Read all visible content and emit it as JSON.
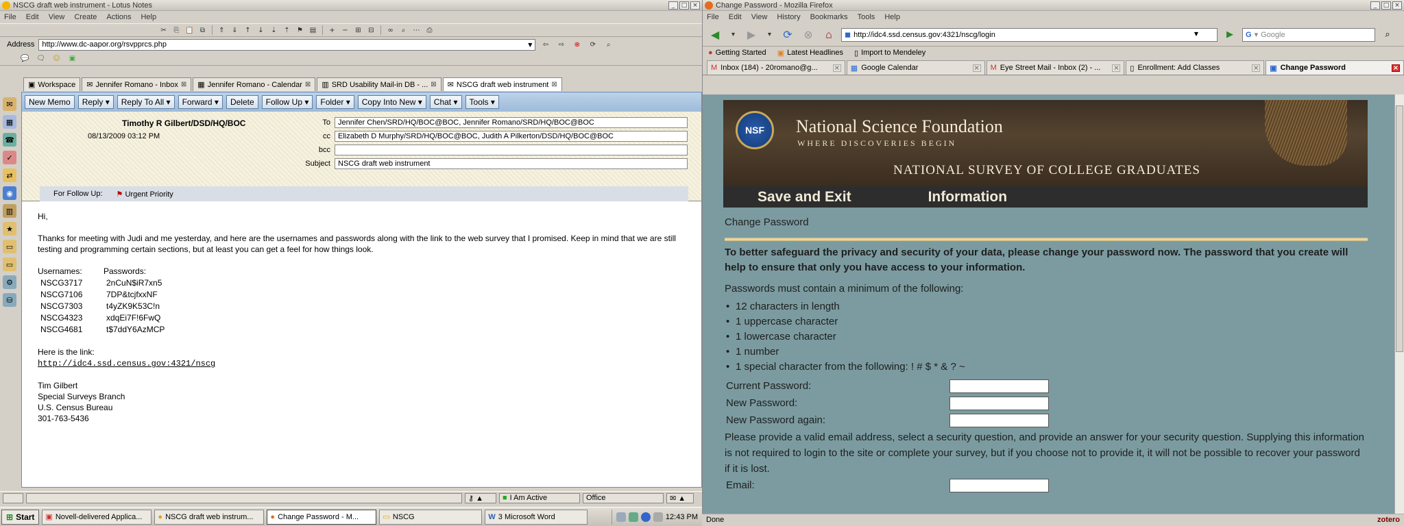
{
  "lotus": {
    "title": "NSCG draft web instrument - Lotus Notes",
    "menu": [
      "File",
      "Edit",
      "View",
      "Create",
      "Actions",
      "Help"
    ],
    "address_label": "Address",
    "address_url": "http://www.dc-aapor.org/rsvpprcs.php",
    "tabs": [
      {
        "label": "Workspace",
        "active": false
      },
      {
        "label": "Jennifer Romano - Inbox",
        "active": false
      },
      {
        "label": "Jennifer Romano - Calendar",
        "active": false
      },
      {
        "label": "SRD Usability Mail-in DB - ...",
        "active": false
      },
      {
        "label": "NSCG draft web instrument",
        "active": true
      }
    ],
    "actions": [
      "New Memo",
      "Reply ▾",
      "Reply To All ▾",
      "Forward ▾",
      "Delete",
      "Follow Up ▾",
      "Folder ▾",
      "Copy Into New ▾",
      "Chat ▾",
      "Tools ▾"
    ],
    "memo": {
      "from": "Timothy R Gilbert/DSD/HQ/BOC",
      "date": "08/13/2009 03:12 PM",
      "to_label": "To",
      "to": "Jennifer Chen/SRD/HQ/BOC@BOC,      Jennifer Romano/SRD/HQ/BOC@BOC",
      "cc_label": "cc",
      "cc": "Elizabeth D Murphy/SRD/HQ/BOC@BOC,      Judith A Pilkerton/DSD/HQ/BOC@BOC",
      "bcc_label": "bcc",
      "bcc": "",
      "subject_label": "Subject",
      "subject": "NSCG draft web instrument",
      "follow_up_label": "For Follow Up:",
      "priority": "Urgent Priority"
    },
    "body": {
      "greeting": "Hi,",
      "para": "Thanks for meeting with Judi and me yesterday, and here are the usernames and passwords along with the link to the web survey that I promised.  Keep in mind that we are still testing and programming certain sections, but at least you can get a feel for how things look.",
      "usernames_header": "Usernames:",
      "passwords_header": "Passwords:",
      "credentials": [
        {
          "user": "NSCG3717",
          "pass": "2nCuN$iR7xn5"
        },
        {
          "user": "NSCG7106",
          "pass": "7DP&tcjfxxNF"
        },
        {
          "user": "NSCG7303",
          "pass": "t4yZK9K53C!n"
        },
        {
          "user": "NSCG4323",
          "pass": "xdqEi7F!6FwQ"
        },
        {
          "user": "NSCG4681",
          "pass": "t$7ddY6AzMCP"
        }
      ],
      "link_intro": "Here is the link:",
      "link": "http://idc4.ssd.census.gov:4321/nscg",
      "sig": [
        "Tim Gilbert",
        "Special Surveys Branch",
        "U.S. Census Bureau",
        "301-763-5436"
      ]
    },
    "status": {
      "presence": "I Am Active",
      "location": "Office"
    }
  },
  "firefox": {
    "title": "Change Password - Mozilla Firefox",
    "menu": [
      "File",
      "Edit",
      "View",
      "History",
      "Bookmarks",
      "Tools",
      "Help"
    ],
    "url": "http://idc4.ssd.census.gov:4321/nscg/login",
    "search_placeholder": "Google",
    "bookmarks": [
      "Getting Started",
      "Latest Headlines",
      "Import to Mendeley"
    ],
    "tabs": [
      {
        "label": "Inbox (184) - 20romano@g...",
        "active": false
      },
      {
        "label": "Google Calendar",
        "active": false
      },
      {
        "label": "Eye Street Mail - Inbox (2) - ...",
        "active": false
      },
      {
        "label": "Enrollment: Add Classes",
        "active": false
      },
      {
        "label": "Change Password",
        "active": true
      }
    ],
    "status_text": "Done",
    "zotero": "zotero"
  },
  "page": {
    "seal": "NSF",
    "org_name": "National Science Foundation",
    "tagline": "WHERE DISCOVERIES BEGIN",
    "survey_name": "NATIONAL SURVEY OF COLLEGE GRADUATES",
    "nav": [
      "Save and Exit",
      "Information"
    ],
    "heading": "Change Password",
    "warning": "To better safeguard the privacy and security of your data, please change your password now. The password that you create will help to ensure that only you have access to your information.",
    "req_intro": "Passwords must contain a minimum of the following:",
    "requirements": [
      "12 characters in length",
      "1 uppercase character",
      "1 lowercase character",
      "1 number",
      "1 special character from the following:  ! # $ * & ? ~"
    ],
    "fields": [
      "Current Password:",
      "New Password:",
      "New Password again:"
    ],
    "info": "Please provide a valid email address, select a security question, and provide an answer for your security question. Supplying this information is not required to login to the site or complete your survey, but if you choose not to provide it, it will not be possible to recover your password if it is lost.",
    "email_label": "Email:"
  },
  "taskbar": {
    "start": "Start",
    "items": [
      {
        "label": "Novell-delivered Applica...",
        "active": false
      },
      {
        "label": "NSCG draft web instrum...",
        "active": false
      },
      {
        "label": "Change Password - M...",
        "active": true
      },
      {
        "label": "NSCG",
        "active": false
      },
      {
        "label": "3 Microsoft Word",
        "active": false
      }
    ],
    "clock": "12:43 PM"
  },
  "colors": {
    "nsf_brown": "#4a3a2a",
    "page_bg": "#7b9ba0",
    "nav_dark": "#2d2d2d",
    "lotus_action": "#b0c8e2"
  }
}
